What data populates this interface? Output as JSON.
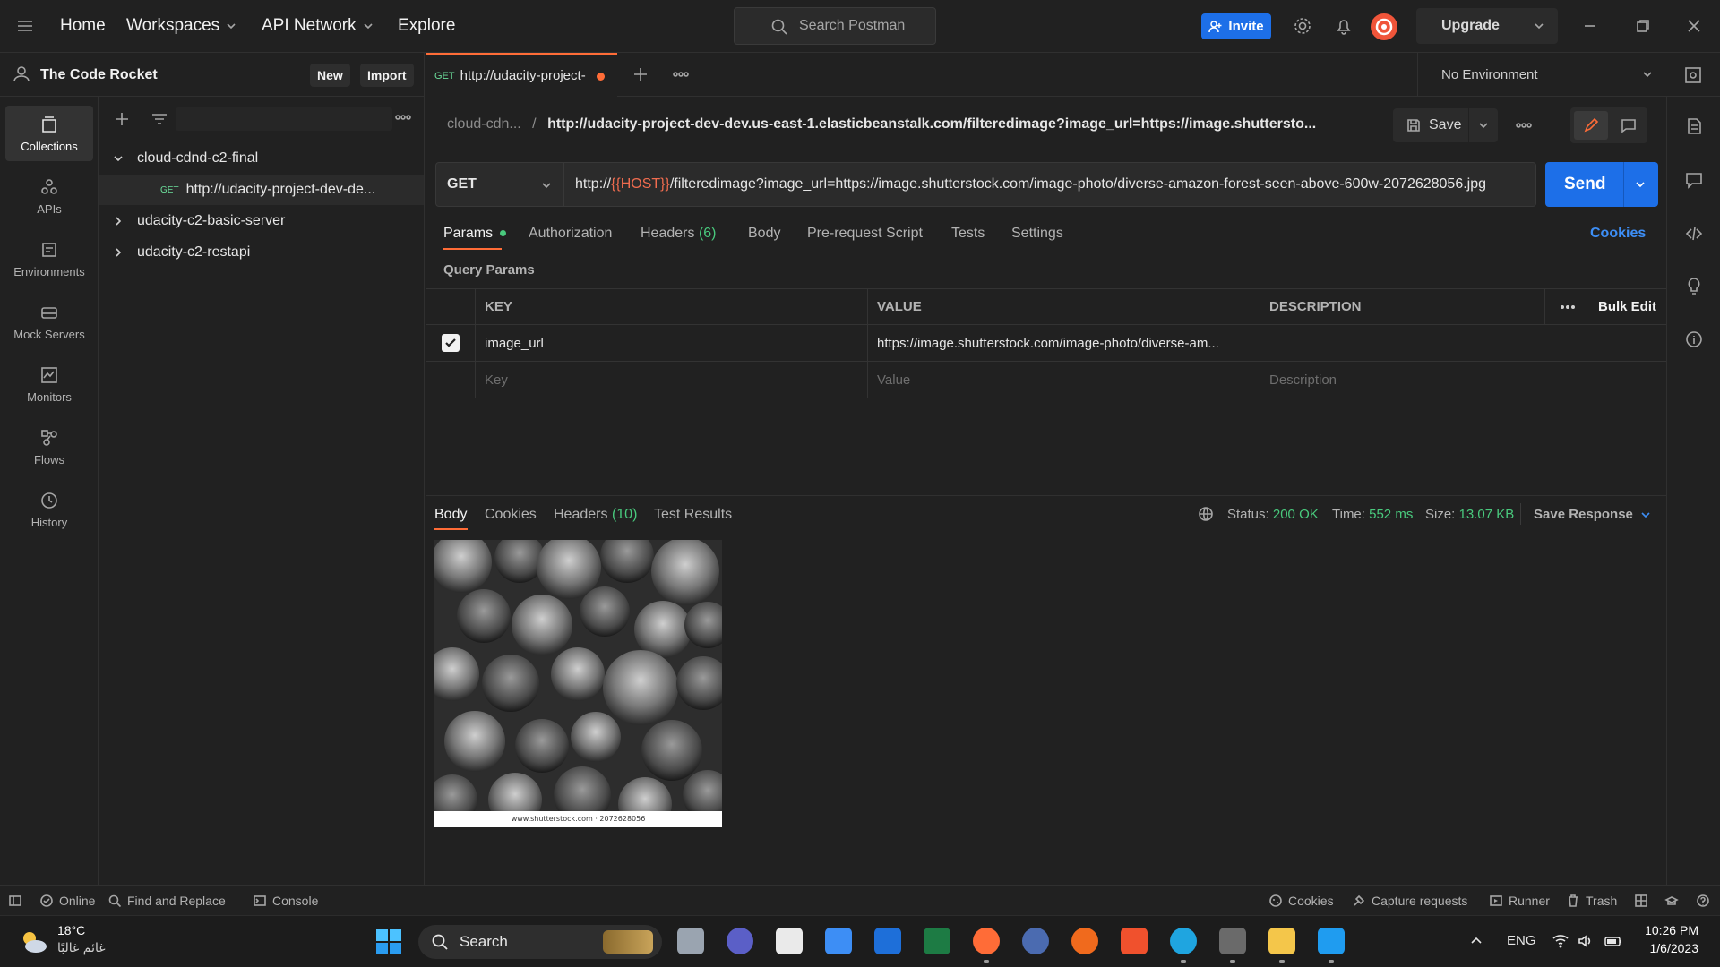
{
  "topbar": {
    "nav": [
      "Home",
      "Workspaces",
      "API Network",
      "Explore"
    ],
    "search_placeholder": "Search Postman",
    "invite_label": "Invite",
    "upgrade_label": "Upgrade"
  },
  "workspace": {
    "name": "The Code Rocket",
    "new_label": "New",
    "import_label": "Import"
  },
  "rail": [
    "Collections",
    "APIs",
    "Environments",
    "Mock Servers",
    "Monitors",
    "Flows",
    "History"
  ],
  "collections": [
    {
      "name": "cloud-cdnd-c2-final",
      "expanded": true
    },
    {
      "method": "GET",
      "name": "http://udacity-project-dev-de..."
    },
    {
      "name": "udacity-c2-basic-server",
      "expanded": false
    },
    {
      "name": "udacity-c2-restapi",
      "expanded": false
    }
  ],
  "tab": {
    "method": "GET",
    "title": "http://udacity-project-",
    "environment": "No Environment"
  },
  "request": {
    "breadcrumb_parent": "cloud-cdn...",
    "breadcrumb_sep": "/",
    "breadcrumb_url": "http://udacity-project-dev-dev.us-east-1.elasticbeanstalk.com/filteredimage?image_url=https://image.shuttersto...",
    "save_label": "Save",
    "method": "GET",
    "url_prefix": "http://",
    "url_var": "{{HOST}}",
    "url_suffix": "/filteredimage?image_url=https://image.shutterstock.com/image-photo/diverse-amazon-forest-seen-above-600w-2072628056.jpg",
    "send_label": "Send"
  },
  "request_tabs": {
    "params": "Params",
    "authorization": "Authorization",
    "headers": "Headers",
    "headers_count": "(6)",
    "body": "Body",
    "prerequest": "Pre-request Script",
    "tests": "Tests",
    "settings": "Settings",
    "cookies": "Cookies"
  },
  "params": {
    "section_label": "Query Params",
    "headers": {
      "key": "KEY",
      "value": "VALUE",
      "description": "DESCRIPTION",
      "bulk_edit": "Bulk Edit"
    },
    "rows": [
      {
        "checked": true,
        "key": "image_url",
        "value": "https://image.shutterstock.com/image-photo/diverse-am...",
        "description": ""
      }
    ],
    "placeholder": {
      "key": "Key",
      "value": "Value",
      "description": "Description"
    }
  },
  "response": {
    "tabs": {
      "body": "Body",
      "cookies": "Cookies",
      "headers": "Headers",
      "headers_count": "(10)",
      "test_results": "Test Results"
    },
    "status_label": "Status:",
    "status_value": "200 OK",
    "time_label": "Time:",
    "time_value": "552 ms",
    "size_label": "Size:",
    "size_value": "13.07 KB",
    "save_response": "Save Response",
    "image_caption": "www.shutterstock.com · 2072628056"
  },
  "statusbar": {
    "online": "Online",
    "find_replace": "Find and Replace",
    "console": "Console",
    "cookies": "Cookies",
    "capture": "Capture requests",
    "runner": "Runner",
    "trash": "Trash"
  },
  "taskbar": {
    "weather_temp": "18°C",
    "weather_desc": "غائم غالبًا",
    "search_label": "Search",
    "language": "ENG",
    "time": "10:26 PM",
    "date": "1/6/2023"
  },
  "colors": {
    "accent": "#1d6fe8",
    "orange": "#ff6c37",
    "green": "#49c97d"
  }
}
